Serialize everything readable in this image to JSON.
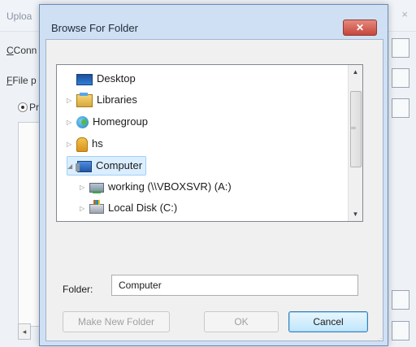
{
  "background": {
    "title": "Uploa",
    "close_glyph": "×",
    "labels": {
      "connection": "Conn",
      "connection_hotkey": "C",
      "file_path": "File p",
      "file_path_hotkey": "F",
      "radio_option": "Pr"
    },
    "scroll_left_glyph": "◂"
  },
  "dialog": {
    "title": "Browse For Folder",
    "close_glyph": "✕",
    "tree": {
      "items": [
        {
          "label": "Desktop",
          "icon": "desktop-icon",
          "arrow": ""
        },
        {
          "label": "Libraries",
          "icon": "libraries-icon",
          "arrow": "▷"
        },
        {
          "label": "Homegroup",
          "icon": "homegroup-icon",
          "arrow": "▷"
        },
        {
          "label": "hs",
          "icon": "user-folder-icon",
          "arrow": "▷"
        },
        {
          "label": "Computer",
          "icon": "computer-icon",
          "arrow": "◢",
          "selected": true
        },
        {
          "label": "working (\\\\VBOXSVR) (A:)",
          "icon": "network-drive-icon",
          "arrow": "▷"
        },
        {
          "label": "Local Disk (C:)",
          "icon": "local-disk-icon",
          "arrow": "▷"
        }
      ],
      "scroll_up_glyph": "▲",
      "scroll_down_glyph": "▼"
    },
    "folder_label": "Folder:",
    "folder_value": "Computer",
    "buttons": {
      "make_new_folder": "Make New Folder",
      "ok": "OK",
      "cancel": "Cancel"
    }
  },
  "colors": {
    "selection": "#dbeeff",
    "close_button": "#c7453a",
    "dialog_frame": "#cfe0f4"
  }
}
